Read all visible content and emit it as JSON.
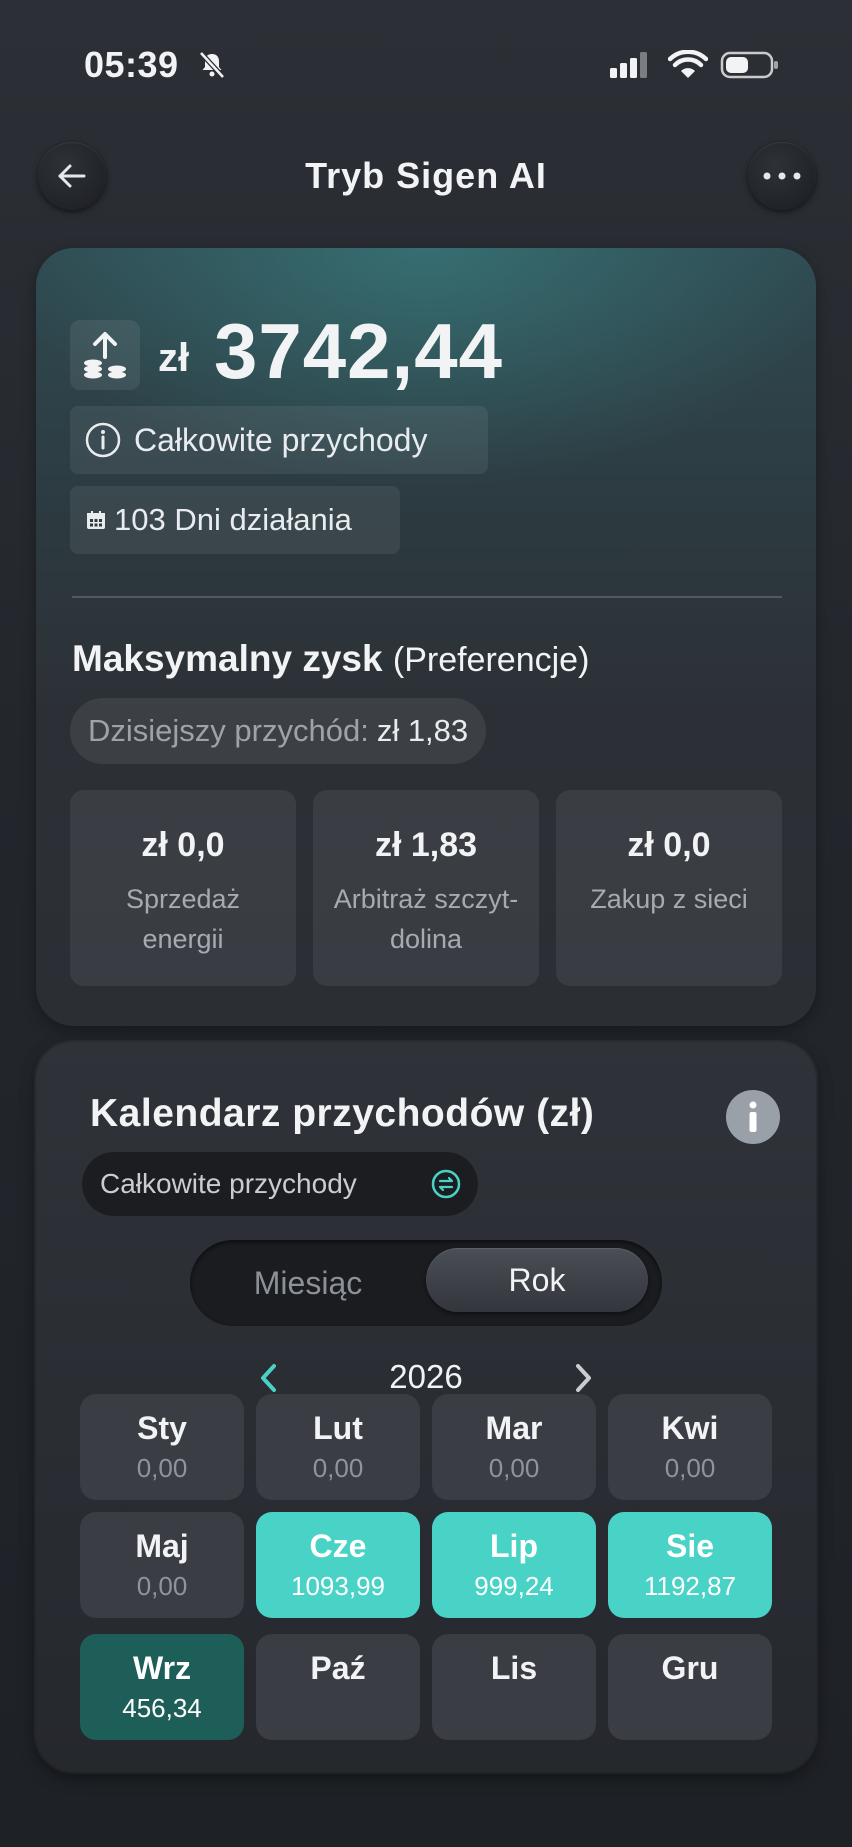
{
  "status_bar": {
    "time": "05:39"
  },
  "header": {
    "title": "Tryb Sigen AI"
  },
  "summary": {
    "currency_symbol": "zł",
    "total_value": "3742,44",
    "total_label": "Całkowite przychody",
    "days_label": "103 Dni działania"
  },
  "mode": {
    "title": "Maksymalny zysk",
    "subtitle": "(Preferencje)",
    "today_label": "Dzisiejszy przychód:",
    "today_value": "zł 1,83",
    "stats": [
      {
        "value": "zł 0,0",
        "label": "Sprzedaż energii"
      },
      {
        "value": "zł 1,83",
        "label": "Arbitraż szczyt-dolina"
      },
      {
        "value": "zł 0,0",
        "label": "Zakup z sieci"
      }
    ]
  },
  "calendar": {
    "title": "Kalendarz przychodów (zł)",
    "selector_label": "Całkowite przychody",
    "tabs": {
      "month": "Miesiąc",
      "year": "Rok",
      "active": "year"
    },
    "year": "2026",
    "accent_color": "#49d2c6",
    "current_color": "#1e5e58",
    "months": [
      {
        "name": "Sty",
        "value": "0,00"
      },
      {
        "name": "Lut",
        "value": "0,00"
      },
      {
        "name": "Mar",
        "value": "0,00"
      },
      {
        "name": "Kwi",
        "value": "0,00"
      },
      {
        "name": "Maj",
        "value": "0,00"
      },
      {
        "name": "Cze",
        "value": "1093,99"
      },
      {
        "name": "Lip",
        "value": "999,24"
      },
      {
        "name": "Sie",
        "value": "1192,87"
      },
      {
        "name": "Wrz",
        "value": "456,34"
      },
      {
        "name": "Paź",
        "value": ""
      },
      {
        "name": "Lis",
        "value": ""
      },
      {
        "name": "Gru",
        "value": ""
      }
    ]
  }
}
